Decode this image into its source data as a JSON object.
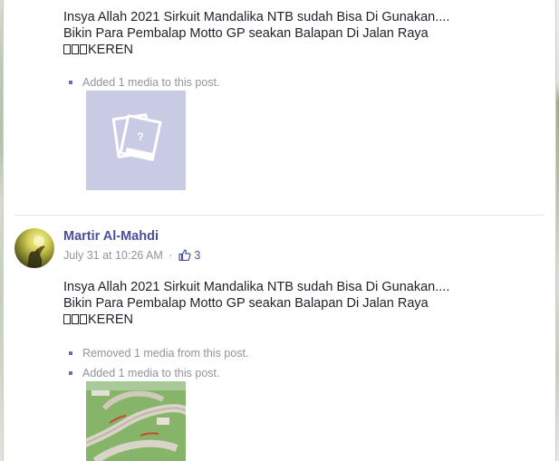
{
  "post_top": {
    "text_lines": [
      "Insya Allah 2021 Sirkuit Mandalika NTB sudah Bisa Di Gunakan....",
      "Bikin Para Pembalap Motto GP seakan Balapan Di Jalan Raya"
    ],
    "text_suffix": "KEREN",
    "log": [
      "Added 1 media to this post."
    ],
    "media_icon": "missing-photo-icon"
  },
  "post_bottom": {
    "author": "Martir Al-Mahdi",
    "timestamp": "July 31 at 10:26 AM",
    "separator": "·",
    "like_count": "3",
    "text_lines": [
      "Insya Allah 2021 Sirkuit Mandalika NTB sudah Bisa Di Gunakan....",
      "Bikin Para Pembalap Motto GP seakan Balapan Di Jalan Raya"
    ],
    "text_suffix": "KEREN",
    "log": [
      "Removed 1 media from this post.",
      "Added 1 media to this post."
    ]
  },
  "colors": {
    "author_link": "#4b4f9c",
    "meta_text": "#90949c",
    "placeholder_bg": "#c8cbe3",
    "body_text": "#1d2129"
  }
}
